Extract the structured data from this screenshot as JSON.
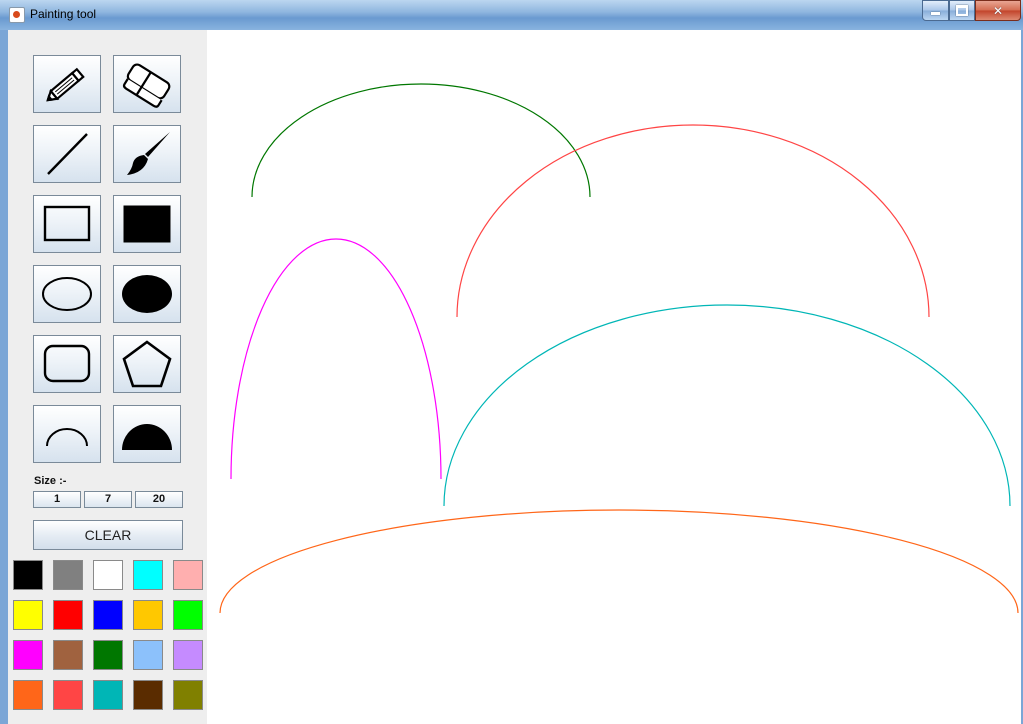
{
  "window": {
    "title": "Painting tool",
    "app_icon": "java-cup-icon"
  },
  "window_buttons": {
    "minimize": "minimize-icon",
    "maximize": "maximize-icon",
    "close": "close-icon"
  },
  "tools": [
    {
      "name": "pencil",
      "icon": "pencil-icon"
    },
    {
      "name": "eraser",
      "icon": "eraser-icon"
    },
    {
      "name": "line",
      "icon": "line-icon"
    },
    {
      "name": "brush",
      "icon": "brush-icon"
    },
    {
      "name": "rectangle",
      "icon": "rectangle-icon"
    },
    {
      "name": "filled-rectangle",
      "icon": "filled-rectangle-icon"
    },
    {
      "name": "oval",
      "icon": "oval-icon"
    },
    {
      "name": "filled-oval",
      "icon": "filled-oval-icon"
    },
    {
      "name": "rounded-rectangle",
      "icon": "rounded-rectangle-icon"
    },
    {
      "name": "polygon",
      "icon": "pentagon-icon"
    },
    {
      "name": "arc",
      "icon": "arc-icon"
    },
    {
      "name": "filled-arc",
      "icon": "filled-arc-icon"
    }
  ],
  "size": {
    "label": "Size :-",
    "options": [
      "1",
      "7",
      "20"
    ]
  },
  "clear": {
    "label": "CLEAR"
  },
  "palette": [
    "#000000",
    "#808080",
    "#ffffff",
    "#00ffff",
    "#ffafaf",
    "#ffff00",
    "#ff0000",
    "#0000ff",
    "#ffc800",
    "#00ff00",
    "#ff00ff",
    "#a0623f",
    "#007700",
    "#8cc1fb",
    "#c58bff",
    "#ff6619",
    "#ff4545",
    "#00b6b6",
    "#5a2c00",
    "#808000"
  ],
  "canvas": {
    "arcs": [
      {
        "color": "#007700"
      },
      {
        "color": "#ff4545"
      },
      {
        "color": "#ff00ff"
      },
      {
        "color": "#00b6b6"
      },
      {
        "color": "#ff6619"
      }
    ]
  }
}
